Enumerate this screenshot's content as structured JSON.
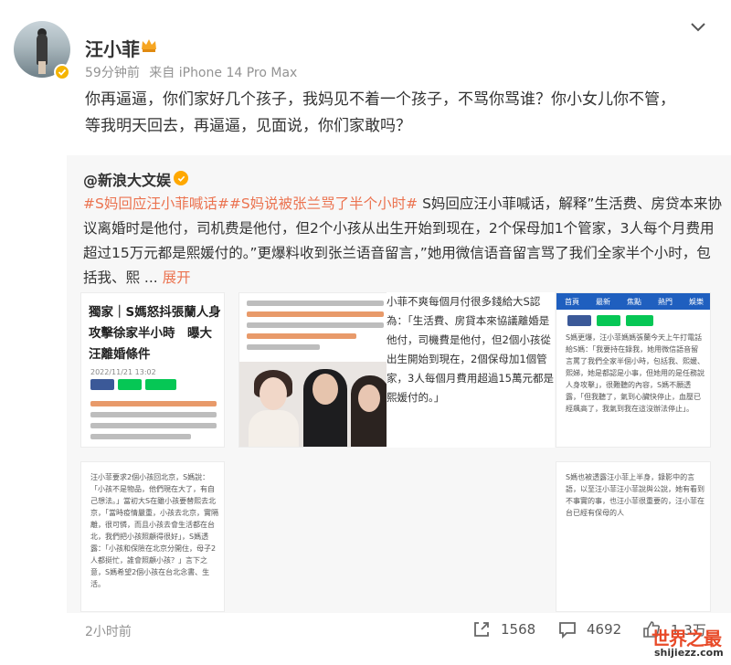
{
  "author": {
    "name": "汪小菲",
    "time": "59分钟前",
    "source": "来自 iPhone 14 Pro Max"
  },
  "post": {
    "text_line1": "你再逼逼，你们家好几个孩子，我妈见不着一个孩子，不骂你骂谁？你小女儿你不管，",
    "text_line2": "等我明天回去，再逼逼，见面说，你们家敢吗？"
  },
  "repost": {
    "author": "@新浪大文娱",
    "tag1": "#S妈回应汪小菲喊话#",
    "tag2": "#S妈说被张兰骂了半个小时#",
    "text": " S妈回应汪小菲喊话，解释”生活费、房贷本来协议离婚时是他付，司机费是他付，但2个小孩从出生开始到现在，2个保母加1个管家，3人每个月费用超过15万元都是熙媛付的。”更爆料收到张兰语音留言，”她用微信语音留言骂了我们全家半个小时，包括我、熙 ...",
    "expand": " 展开",
    "images": {
      "img1_headline": "獨家｜S媽怒抖張蘭人身攻擊徐家半小時　曝大汪離婚條件",
      "img1_date": "2022/11/21 13:02",
      "img3_text": "小菲不爽每個月付很多錢給大S認為：「生活費、房貸本來協議離婚是他付，司機費是他付，但2個小孩從出生開始到現在，2個保母加1個管家，3人每個月費用超過15萬元都是熙媛付的。」",
      "img4_nav": [
        "首頁",
        "最新",
        "焦點",
        "熱門",
        "娛樂"
      ],
      "img4_text": "S媽更爆，汪小菲媽媽張蘭今天上午打電話給S媽：「我要持在錄我，她用微信語音留言罵了我們全家半個小時，包括我、熙媛、熙娣，她是都認是小事，但她用的是任務說人身攻擊」，很難聽的內容，S媽不願透露，「但我聽了，氣到心臟快停止，血壓已經飆高了，我氣到我在這沒辦法停止」。",
      "img5_text": "汪小菲要求2個小孩回北京，S媽說：「小孩不是物品，他們現在大了，有自己想法。」當初大S在雖小孩要替熙去北京，「當時疫情嚴重，小孩去北京，實隔離，很可憐，而且小孩去會生活都在台北，我們把小孩照顧得很好」，S媽透露：「小孩和保險在北京分開住，母子2人都挺忙，誰會照顧小孩？」言下之意，S媽希望2個小孩在台北念書、生活。",
      "img6_text": "S媽也被透露汪小菲上半身，錄影中的言語，以至汪小菲汪小菲說與公說，她有看到不事實的事，也汪小菲很重要的，汪小菲在台已經有保母的人"
    }
  },
  "footer": {
    "time": "2小时前",
    "reposts": "1568",
    "comments": "4692",
    "likes": "1.3万"
  },
  "watermark": {
    "main": "世界之最",
    "sub": "shijiezz.com"
  },
  "colors": {
    "tag": "#eb7350",
    "meta": "#939393",
    "repost_bg": "#f7f7f7"
  }
}
